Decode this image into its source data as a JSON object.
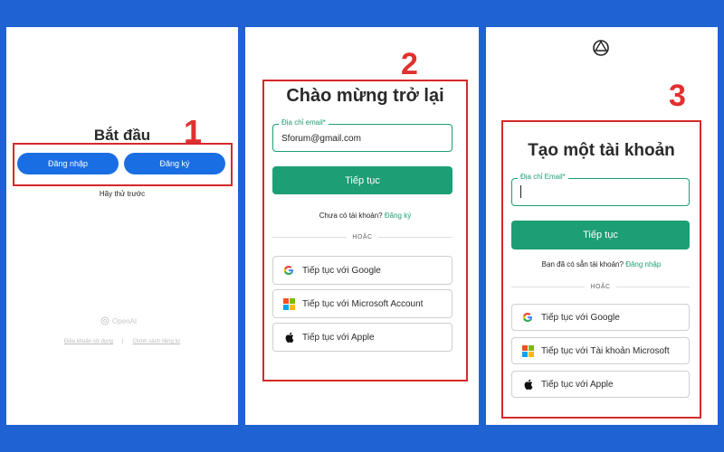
{
  "panel1": {
    "title": "Bắt đầu",
    "login_button": "Đăng nhập",
    "signup_button": "Đăng ký",
    "try_first": "Hãy thử trước",
    "brand": "OpenAI",
    "terms_link": "Điều khoản sử dụng",
    "separator": "|",
    "privacy_link": "Chính sách riêng tư",
    "step_number": "1"
  },
  "panel2": {
    "step_number": "2",
    "title": "Chào mừng trở lại",
    "email_label": "Địa chỉ email*",
    "email_value": "Sforum@gmail.com",
    "continue_button": "Tiếp tục",
    "no_account_text": "Chưa có tài khoản?",
    "signup_link": "Đăng ký",
    "or_text": "HOẶC",
    "google_button": "Tiếp tục với Google",
    "microsoft_button": "Tiếp tục với Microsoft Account",
    "apple_button": "Tiếp tục với Apple"
  },
  "panel3": {
    "step_number": "3",
    "title": "Tạo một tài khoản",
    "email_label": "Địa chỉ Email*",
    "continue_button": "Tiếp tục",
    "have_account_text": "Bạn đã có sẵn tài khoản?",
    "login_link": "Đăng nhập",
    "or_text": "HOẶC",
    "google_button": "Tiếp tục với Google",
    "microsoft_button": "Tiếp tục với Tài khoản Microsoft",
    "apple_button": "Tiếp tục với Apple"
  },
  "colors": {
    "background": "#1f63d3",
    "primary_blue": "#1a6ee3",
    "accent_green": "#1d9e75",
    "highlight_red": "#d42a2a"
  },
  "icons": [
    "google-icon",
    "microsoft-icon",
    "apple-icon",
    "openai-logo-icon"
  ]
}
